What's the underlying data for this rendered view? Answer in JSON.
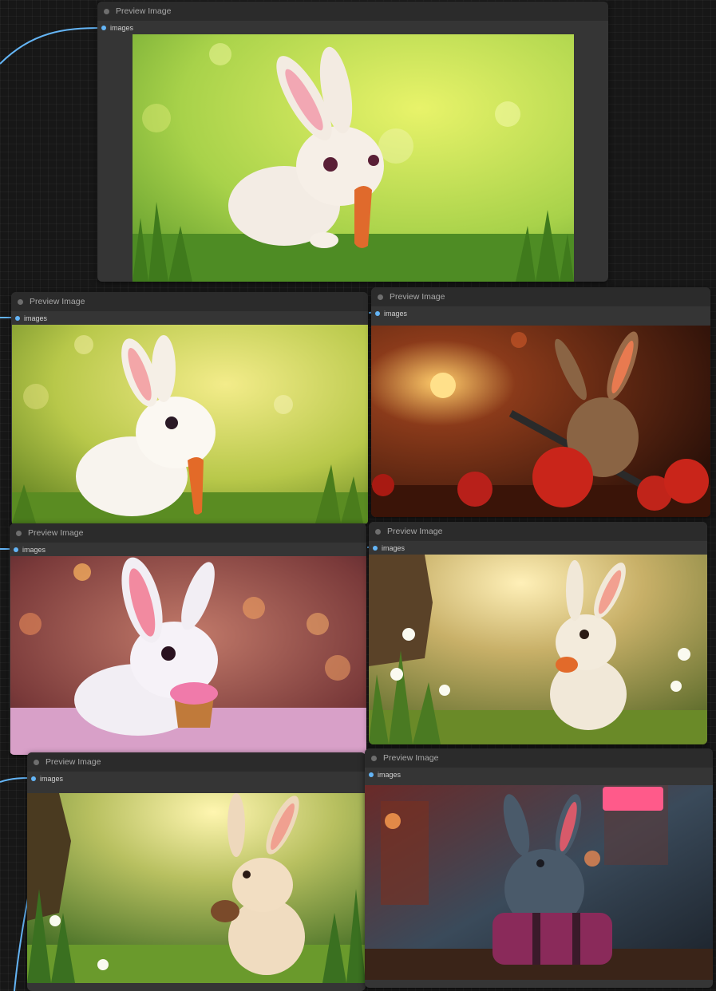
{
  "nodes": [
    {
      "id": "n1",
      "title": "Preview Image",
      "input": "images",
      "scene": "spring-meadow-carrot"
    },
    {
      "id": "n2",
      "title": "Preview Image",
      "input": "images",
      "scene": "fluffy-bunny-carrot"
    },
    {
      "id": "n3",
      "title": "Preview Image",
      "input": "images",
      "scene": "bunny-tomatoes-rifle"
    },
    {
      "id": "n4",
      "title": "Preview Image",
      "input": "images",
      "scene": "pink-bokeh-cupcake"
    },
    {
      "id": "n5",
      "title": "Preview Image",
      "input": "images",
      "scene": "daisy-tree-carrot"
    },
    {
      "id": "n6",
      "title": "Preview Image",
      "input": "images",
      "scene": "forest-muffin"
    },
    {
      "id": "n7",
      "title": "Preview Image",
      "input": "images",
      "scene": "neon-street-bag"
    }
  ],
  "colors": {
    "canvas_bg": "#171717",
    "node_bg": "#353535",
    "node_header": "#2b2b2b",
    "slot_images": "#64b5f6",
    "wire": "#64b5f6"
  }
}
